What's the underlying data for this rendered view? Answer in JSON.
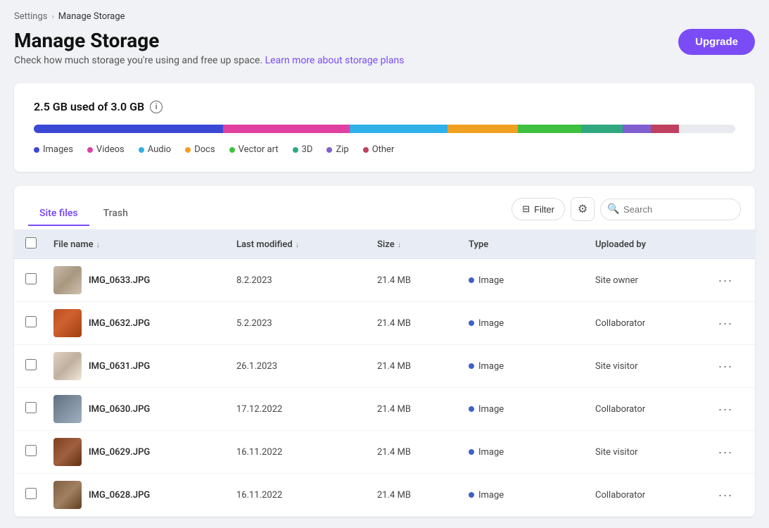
{
  "breadcrumb": {
    "parent": "Settings",
    "current": "Manage Storage"
  },
  "page": {
    "title": "Manage Storage",
    "subtitle": "Check how much storage you're using and free up space.",
    "learn_more_link": "Learn more about storage plans",
    "upgrade_label": "Upgrade"
  },
  "storage": {
    "used_label": "2.5 GB used of 3.0 GB",
    "info_icon": "ℹ",
    "segments": [
      {
        "label": "Images",
        "color": "#3b48d4",
        "width": 27,
        "dot": "#3b48d4"
      },
      {
        "label": "Videos",
        "color": "#e040a0",
        "width": 18,
        "dot": "#e040a0"
      },
      {
        "label": "Audio",
        "color": "#30b0e8",
        "width": 14,
        "dot": "#30b0e8"
      },
      {
        "label": "Docs",
        "color": "#f0a020",
        "width": 10,
        "dot": "#f0a020"
      },
      {
        "label": "Vector art",
        "color": "#40c040",
        "width": 9,
        "dot": "#40c040"
      },
      {
        "label": "3D",
        "color": "#30a880",
        "width": 6,
        "dot": "#30a880"
      },
      {
        "label": "Zip",
        "color": "#8060d0",
        "width": 4,
        "dot": "#8060d0"
      },
      {
        "label": "Other",
        "color": "#c04060",
        "width": 4,
        "dot": "#c04060"
      }
    ]
  },
  "tabs": [
    {
      "label": "Site files",
      "active": true
    },
    {
      "label": "Trash",
      "active": false
    }
  ],
  "toolbar": {
    "filter_label": "Filter",
    "search_placeholder": "Search"
  },
  "table": {
    "headers": [
      {
        "label": "File name",
        "sortable": true
      },
      {
        "label": "Last modified",
        "sortable": true
      },
      {
        "label": "Size",
        "sortable": true
      },
      {
        "label": "Type",
        "sortable": false
      },
      {
        "label": "Uploaded by",
        "sortable": false
      }
    ],
    "rows": [
      {
        "id": 1,
        "name": "IMG_0633.JPG",
        "date": "8.2.2023",
        "size": "21.4 MB",
        "type": "Image",
        "uploaded_by": "Site owner",
        "thumb_class": "thumb-1"
      },
      {
        "id": 2,
        "name": "IMG_0632.JPG",
        "date": "5.2.2023",
        "size": "21.4 MB",
        "type": "Image",
        "uploaded_by": "Collaborator",
        "thumb_class": "thumb-2"
      },
      {
        "id": 3,
        "name": "IMG_0631.JPG",
        "date": "26.1.2023",
        "size": "21.4 MB",
        "type": "Image",
        "uploaded_by": "Site visitor",
        "thumb_class": "thumb-3"
      },
      {
        "id": 4,
        "name": "IMG_0630.JPG",
        "date": "17.12.2022",
        "size": "21.4 MB",
        "type": "Image",
        "uploaded_by": "Collaborator",
        "thumb_class": "thumb-4"
      },
      {
        "id": 5,
        "name": "IMG_0629.JPG",
        "date": "16.11.2022",
        "size": "21.4 MB",
        "type": "Image",
        "uploaded_by": "Site visitor",
        "thumb_class": "thumb-5"
      },
      {
        "id": 6,
        "name": "IMG_0628.JPG",
        "date": "16.11.2022",
        "size": "21.4 MB",
        "type": "Image",
        "uploaded_by": "Collaborator",
        "thumb_class": "thumb-6"
      }
    ]
  },
  "colors": {
    "accent": "#7b4cf5",
    "image_dot": "#4060c8"
  }
}
